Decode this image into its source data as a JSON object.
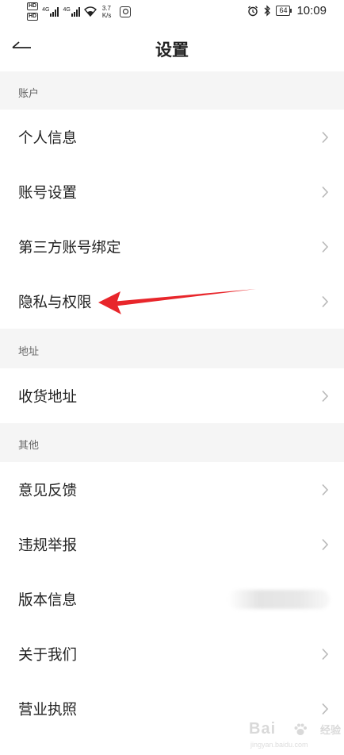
{
  "status_bar": {
    "hd_badge": "HD",
    "network_type": "4G",
    "speed_value": "3.7",
    "speed_unit": "K/s",
    "battery": "64",
    "time": "10:09"
  },
  "header": {
    "title": "设置"
  },
  "sections": {
    "account": {
      "label": "账户",
      "items": [
        "个人信息",
        "账号设置",
        "第三方账号绑定",
        "隐私与权限"
      ]
    },
    "address": {
      "label": "地址",
      "items": [
        "收货地址"
      ]
    },
    "other": {
      "label": "其他",
      "items": [
        "意见反馈",
        "违规举报",
        "版本信息",
        "关于我们",
        "营业执照"
      ]
    }
  },
  "annotation": {
    "color": "#e8262b"
  },
  "watermark": {
    "brand": "Bai",
    "sub": "经验",
    "url": "jingyan.baidu.com"
  },
  "colors": {
    "section_bg": "#f5f5f5",
    "text_primary": "#222222",
    "text_secondary": "#666666",
    "chevron": "#b8b8b8"
  }
}
